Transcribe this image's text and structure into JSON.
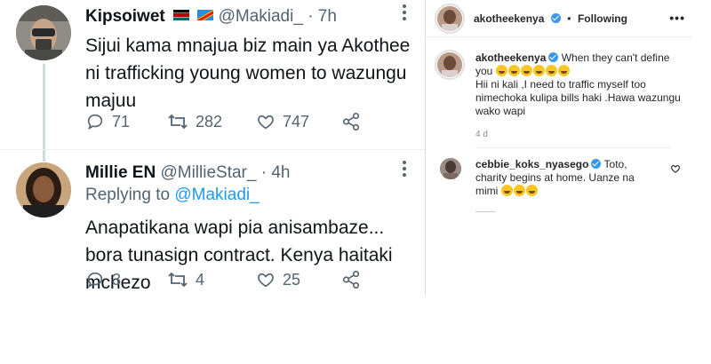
{
  "twitter": {
    "tweets": [
      {
        "name": "Kipsoiwet",
        "handle": "@Makiadi_",
        "time": "· 7h",
        "text": "Sijui kama mnajua biz main ya Akothee ni trafficking young women to wazungu majuu",
        "reply_count": "71",
        "retweet_count": "282",
        "like_count": "747"
      },
      {
        "name": "Millie EN",
        "handle": "@MillieStar_",
        "time": "· 4h",
        "replying_label": "Replying to",
        "replying_to": "@Makiadi_",
        "text": "Anapatikana wapi pia anisambaze... bora tunasign contract. Kenya haitaki mchezo",
        "reply_count": "3",
        "retweet_count": "4",
        "like_count": "25"
      }
    ]
  },
  "instagram": {
    "header": {
      "username": "akotheekenya",
      "separator": "•",
      "follow_status": "Following",
      "more_icon": "ellipsis-icon"
    },
    "caption": {
      "username": "akotheekenya",
      "text_line1": "When they can't define you",
      "text_line2": "Hii ni kali ,I need to traffic myself too nimechoka kulipa bills haki .Hawa wazungu wako wapi"
    },
    "time_ago": "4 d",
    "comment": {
      "username": "cebbie_koks_nyasego",
      "text": "Toto, charity begins at home. Uanze na mimi"
    }
  },
  "colors": {
    "twitter_blue": "#1d9bf0",
    "muted_gray": "#536471",
    "verified_blue": "#3897f0"
  }
}
